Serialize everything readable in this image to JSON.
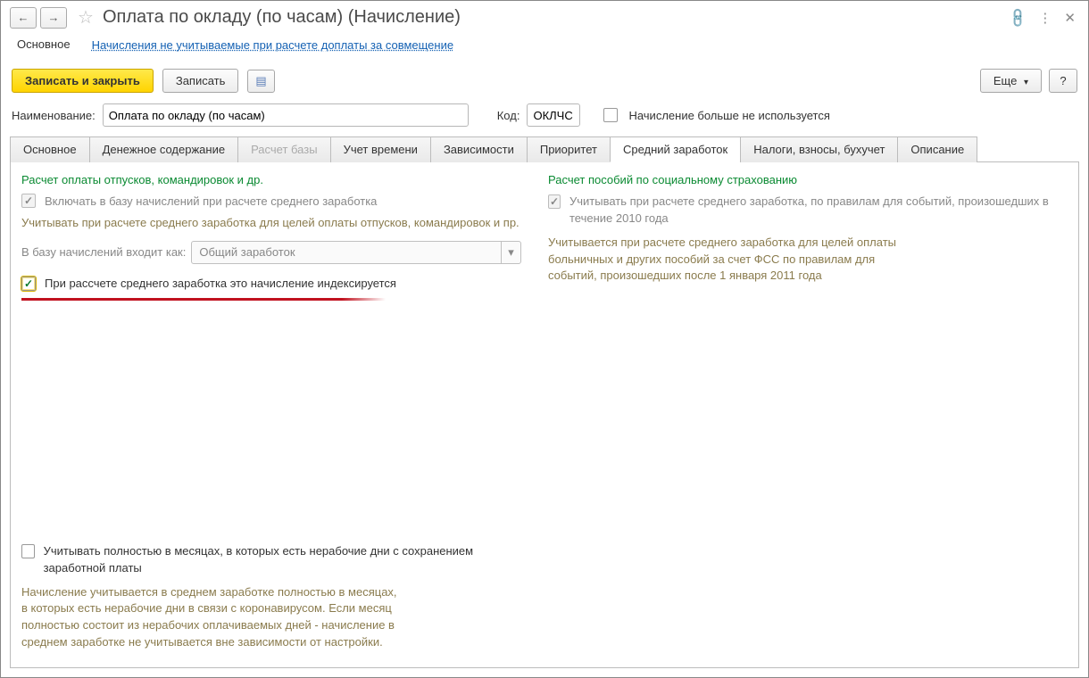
{
  "title": "Оплата по окладу (по часам) (Начисление)",
  "subnav": {
    "main": "Основное",
    "link": "Начисления не учитываемые при расчете доплаты за совмещение"
  },
  "toolbar": {
    "save_close": "Записать и закрыть",
    "save": "Записать",
    "more": "Еще",
    "help": "?"
  },
  "form": {
    "name_label": "Наименование:",
    "name_value": "Оплата по окладу (по часам)",
    "code_label": "Код:",
    "code_value": "ОКЛЧС",
    "not_used_label": "Начисление больше не используется"
  },
  "tabs": [
    {
      "label": "Основное"
    },
    {
      "label": "Денежное содержание"
    },
    {
      "label": "Расчет базы",
      "disabled": true
    },
    {
      "label": "Учет времени"
    },
    {
      "label": "Зависимости"
    },
    {
      "label": "Приоритет"
    },
    {
      "label": "Средний заработок",
      "active": true
    },
    {
      "label": "Налоги, взносы, бухучет"
    },
    {
      "label": "Описание"
    }
  ],
  "left": {
    "heading": "Расчет оплаты отпусков, командировок и др.",
    "include_base": "Включать в базу начислений при расчете среднего заработка",
    "include_desc": "Учитывать при расчете среднего заработка для целей оплаты отпусков, командировок и пр.",
    "base_label": "В базу начислений входит как:",
    "base_value": "Общий заработок",
    "index_label": "При рассчете среднего заработка это начисление индексируется"
  },
  "right": {
    "heading": "Расчет пособий по социальному страхованию",
    "include_2010": "Учитывать при расчете среднего заработка, по правилам для событий, произошедших в течение 2010 года",
    "desc": "Учитывается при расчете среднего заработка для целей оплаты больничных и других пособий за счет ФСС по правилам для событий, произошедших после 1 января 2011 года"
  },
  "bottom": {
    "full_months": "Учитывать полностью в месяцах, в которых есть нерабочие дни с сохранением заработной платы",
    "full_months_desc": "Начисление учитывается в среднем заработке полностью в месяцах, в которых есть нерабочие дни в связи с коронавирусом. Если месяц полностью состоит из нерабочих оплачиваемых дней - начисление в среднем заработке не учитывается вне зависимости от настройки."
  }
}
